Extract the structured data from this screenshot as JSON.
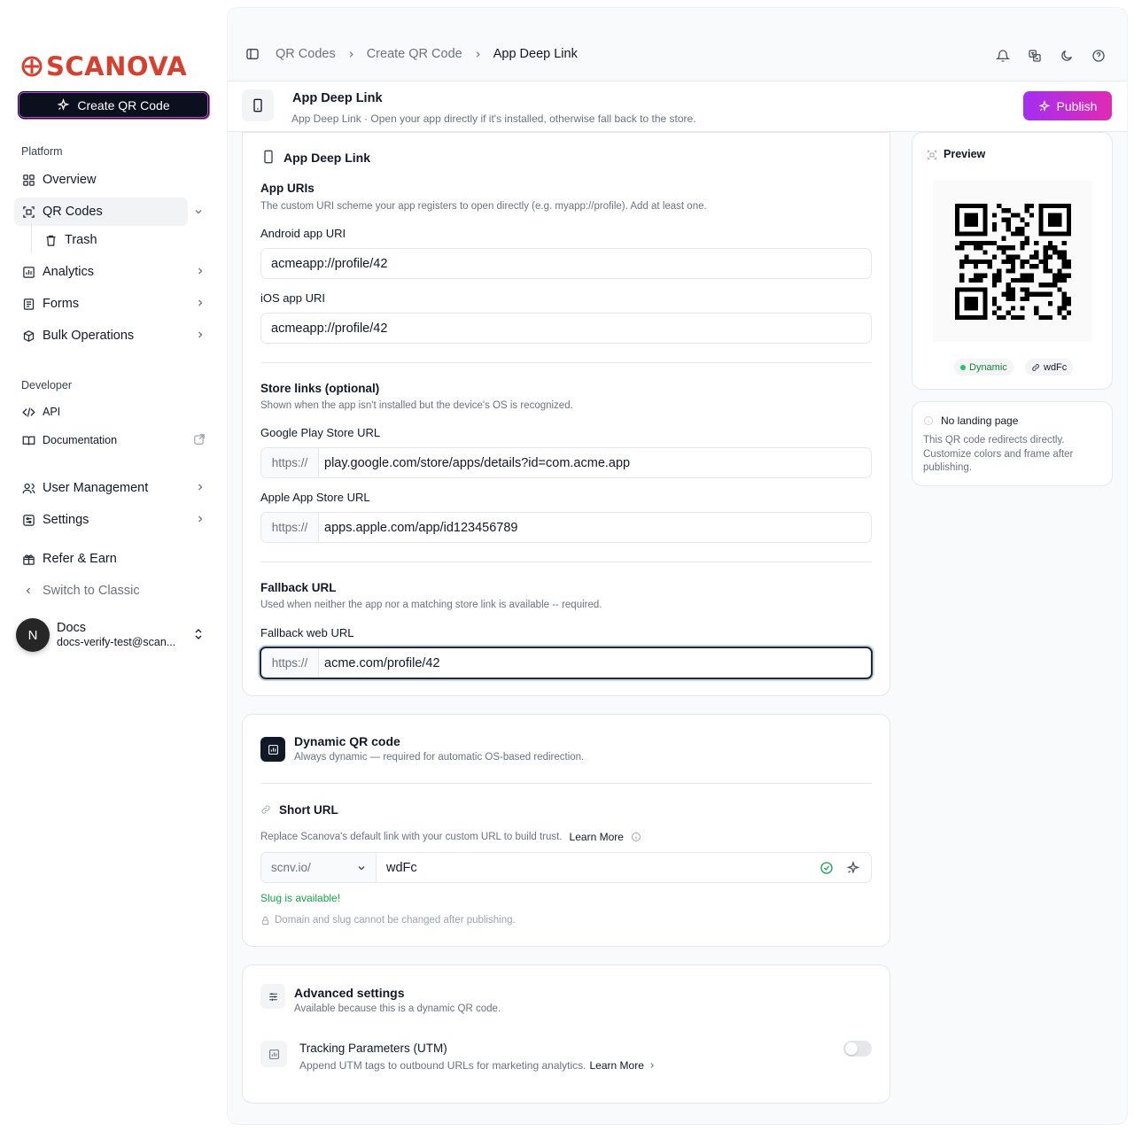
{
  "brand": {
    "name": "SCANOVA",
    "color": "#d6402f"
  },
  "sidebar": {
    "create_button": "Create QR Code",
    "platform_label": "Platform",
    "developer_label": "Developer",
    "items": {
      "overview": "Overview",
      "qr_codes": "QR Codes",
      "trash": "Trash",
      "analytics": "Analytics",
      "forms": "Forms",
      "bulk": "Bulk Operations",
      "api": "API",
      "documentation": "Documentation",
      "user_management": "User Management",
      "settings": "Settings",
      "refer": "Refer & Earn",
      "switch_classic": "Switch to Classic"
    },
    "user": {
      "initial": "N",
      "name": "Docs",
      "email": "docs-verify-test@scan..."
    }
  },
  "breadcrumb": [
    "QR Codes",
    "Create QR Code",
    "App Deep Link"
  ],
  "header": {
    "title": "App Deep Link",
    "subtitle": "App Deep Link · Open your app directly if it's installed, otherwise fall back to the store.",
    "publish": "Publish"
  },
  "deep_link_card": {
    "title": "App Deep Link",
    "app_uris": {
      "title": "App URIs",
      "desc": "The custom URI scheme your app registers to open directly (e.g. myapp://profile). Add at least one.",
      "android_label": "Android app URI",
      "android_value": "acmeapp://profile/42",
      "ios_label": "iOS app URI",
      "ios_value": "acmeapp://profile/42"
    },
    "store_links": {
      "title": "Store links (optional)",
      "desc": "Shown when the app isn't installed but the device's OS is recognized.",
      "google_label": "Google Play Store URL",
      "google_prefix": "https://",
      "google_value": "play.google.com/store/apps/details?id=com.acme.app",
      "apple_label": "Apple App Store URL",
      "apple_prefix": "https://",
      "apple_value": "apps.apple.com/app/id123456789"
    },
    "fallback": {
      "title": "Fallback URL",
      "desc": "Used when neither the app nor a matching store link is available -- required.",
      "label": "Fallback web URL",
      "prefix": "https://",
      "value": "acme.com/profile/42"
    }
  },
  "dynamic_card": {
    "title": "Dynamic QR code",
    "desc": "Always dynamic — required for automatic OS-based redirection.",
    "short_url_title": "Short URL",
    "short_url_desc": "Replace Scanova's default link with your custom URL to build trust.",
    "learn_more": "Learn More",
    "domain": "scnv.io/",
    "slug": "wdFc",
    "status": "Slug is available!",
    "status_color": "#16a34a",
    "lock_note": "Domain and slug cannot be changed after publishing."
  },
  "advanced_card": {
    "title": "Advanced settings",
    "desc": "Available because this is a dynamic QR code.",
    "utm_title": "Tracking Parameters (UTM)",
    "utm_desc": "Append UTM tags to outbound URLs for marketing analytics.",
    "utm_learn_more": "Learn More",
    "utm_enabled": false
  },
  "preview": {
    "title": "Preview",
    "badge_dynamic": "Dynamic",
    "badge_slug": "wdFc",
    "note_title": "No landing page",
    "note_desc": "This QR code redirects directly. Customize colors and frame after publishing."
  }
}
